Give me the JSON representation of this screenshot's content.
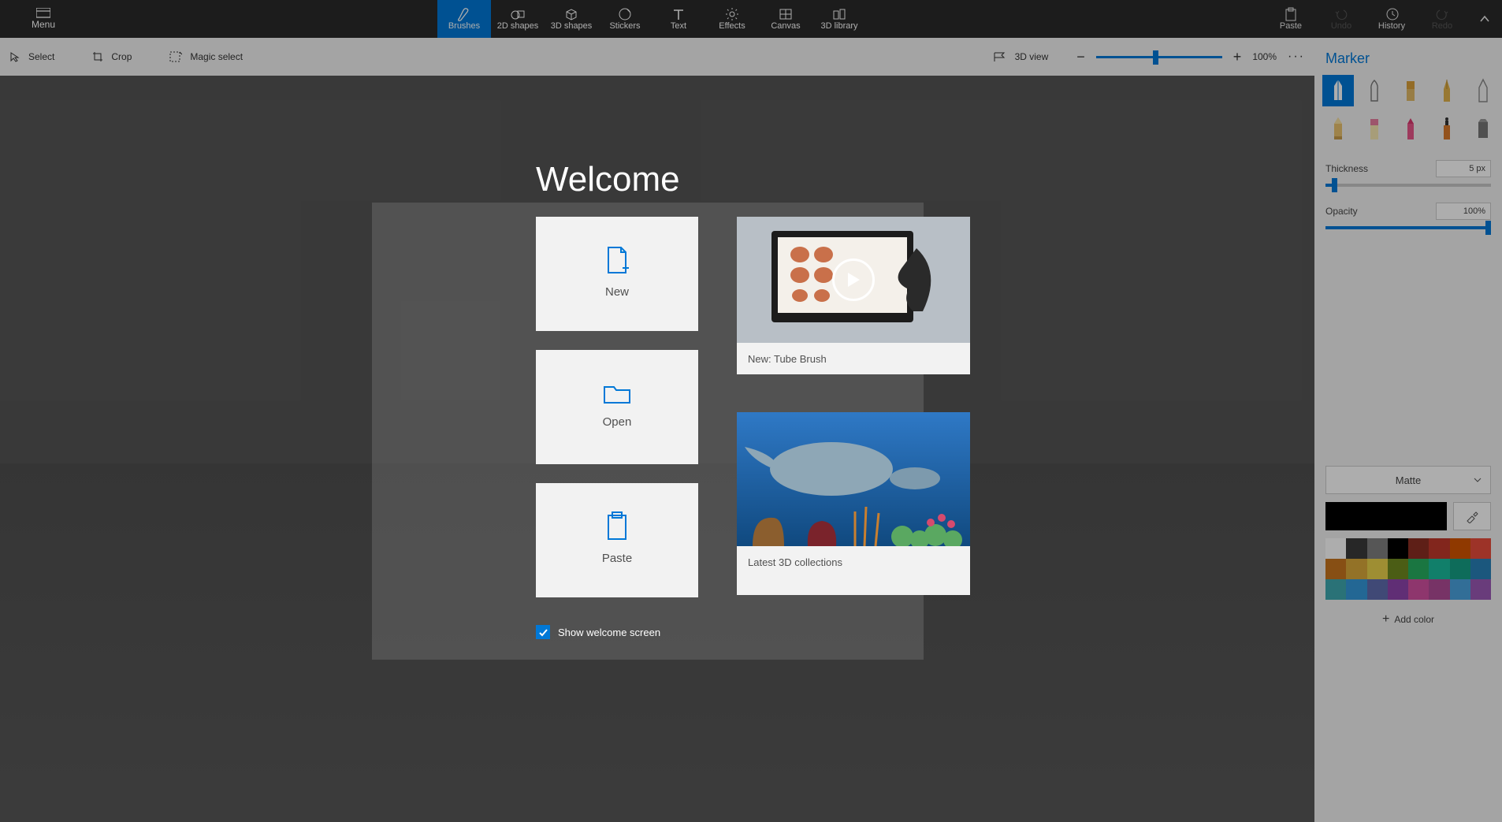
{
  "ribbon": {
    "menu": "Menu",
    "tools": {
      "brushes": "Brushes",
      "shapes2d": "2D shapes",
      "shapes3d": "3D shapes",
      "stickers": "Stickers",
      "text": "Text",
      "effects": "Effects",
      "canvas": "Canvas",
      "library3d": "3D library"
    },
    "right": {
      "paste": "Paste",
      "undo": "Undo",
      "history": "History",
      "redo": "Redo"
    }
  },
  "toolbar": {
    "select": "Select",
    "crop": "Crop",
    "magic": "Magic select",
    "view3d": "3D view",
    "zoom": "100%"
  },
  "panel": {
    "title": "Marker",
    "thickness_label": "Thickness",
    "thickness_value": "5 px",
    "opacity_label": "Opacity",
    "opacity_value": "100%",
    "matte": "Matte",
    "addcolor": "Add color",
    "swatches": [
      "#ffffff",
      "#3a3a3a",
      "#7f7f7f",
      "#000000",
      "#8b2f22",
      "#c0392b",
      "#d35400",
      "#e74c3c",
      "#c8751e",
      "#d9a83a",
      "#e9d24c",
      "#6f8a1f",
      "#27ae60",
      "#1abc9c",
      "#16a085",
      "#2980b9",
      "#3fa8b0",
      "#3498db",
      "#5f6caf",
      "#8e44ad",
      "#d150a1",
      "#b04c97",
      "#4aa3df",
      "#9b59b6"
    ]
  },
  "modal": {
    "title": "Welcome",
    "new": "New",
    "open": "Open",
    "paste_card": "Paste",
    "video_caption": "New: Tube Brush",
    "collections_caption": "Latest 3D collections",
    "show_welcome": "Show welcome screen",
    "show_welcome_checked": true
  }
}
